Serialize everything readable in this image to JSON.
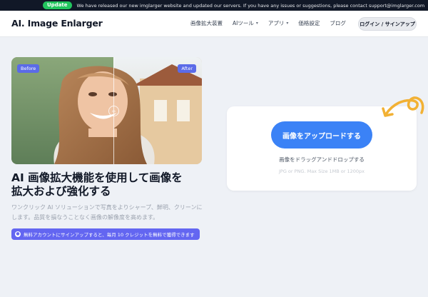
{
  "banner": {
    "pill": "Update",
    "message": "We have released our new imglarger website and updated our servers. If you have any issues or suggestions, please contact support@imglarger.com"
  },
  "nav": {
    "logo": "AI. Image Enlarger",
    "items": [
      {
        "label": "画像拡大装置",
        "dropdown": false
      },
      {
        "label": "AIツール",
        "dropdown": true
      },
      {
        "label": "アプリ",
        "dropdown": true
      },
      {
        "label": "価格設定",
        "dropdown": false
      },
      {
        "label": "ブログ",
        "dropdown": false
      }
    ],
    "login": "ログイン / サインアップ"
  },
  "hero": {
    "before_label": "Before",
    "after_label": "After",
    "headline_line1": "AI 画像拡大機能を使用して画像を",
    "headline_line2": "拡大および強化する",
    "subtext": "ワンクリック AI ソリューションで写真をよりシャープ、鮮明、クリーンにします。品質を損なうことなく画像の解像度を高めます。",
    "promo": "無料アカウントにサインアップすると、毎月 10 クレジットを無料で獲得できます"
  },
  "upload": {
    "button": "画像をアップロードする",
    "drag_text": "画像をドラッグアンドドロップする",
    "limits": "JPG or PNG. Max Size 1MB or 1200px"
  },
  "colors": {
    "accent": "#3b82f6",
    "promo": "#6366f1",
    "update_pill": "#22c55e",
    "arrow": "#f2b134"
  }
}
